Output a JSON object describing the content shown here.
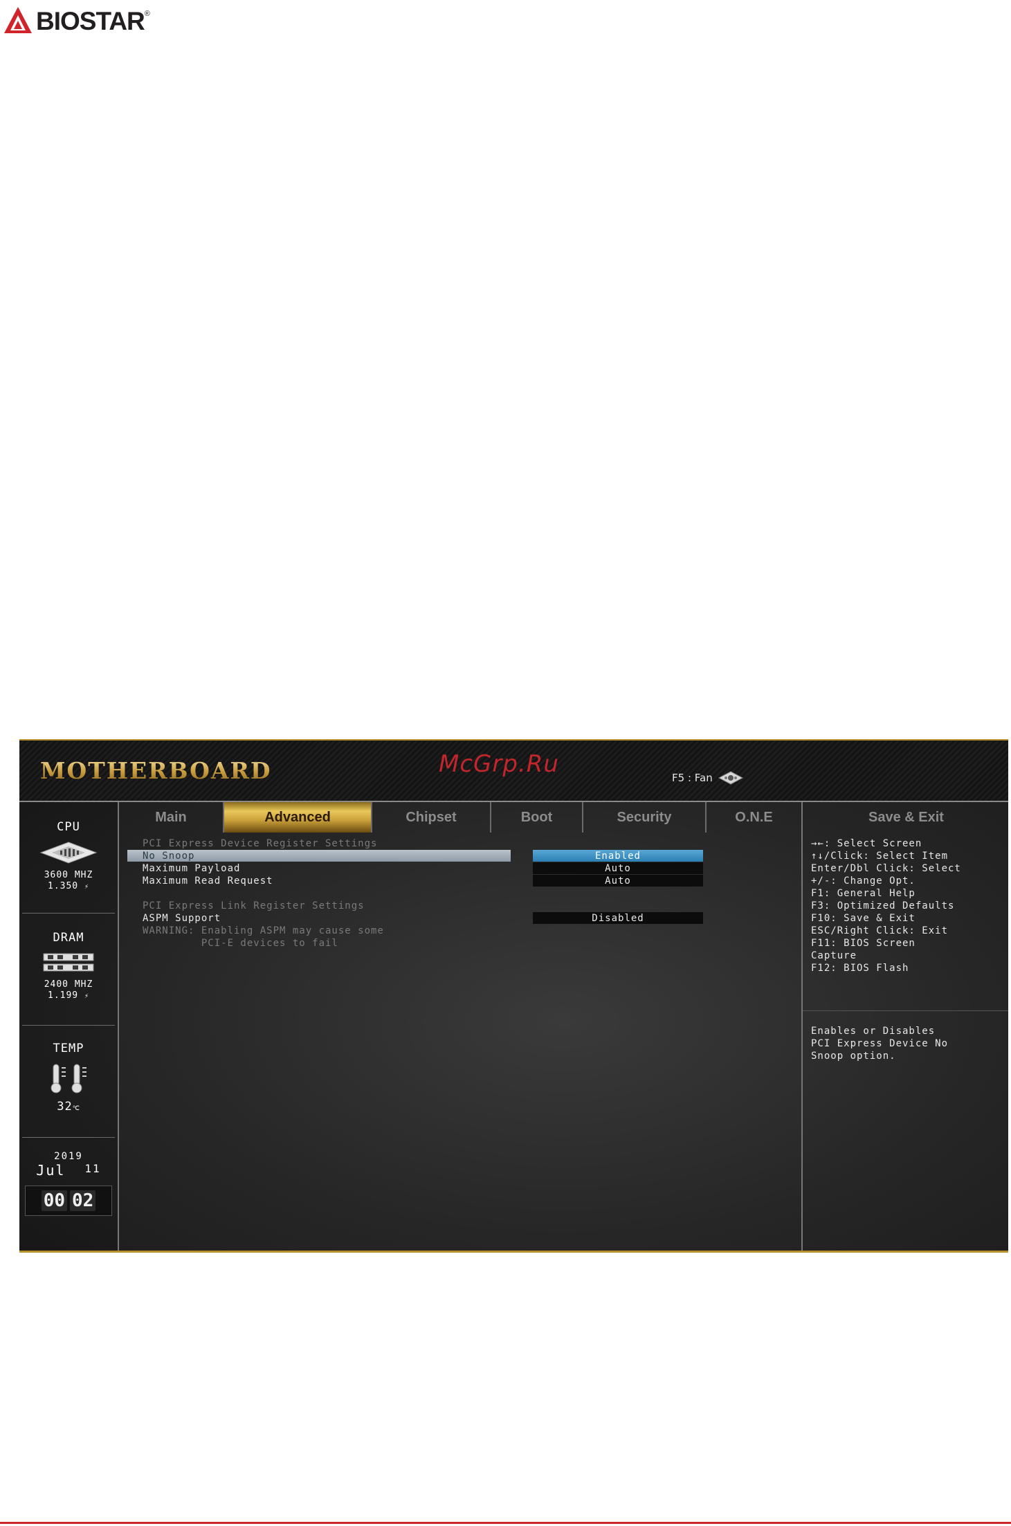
{
  "page": {
    "logo_text": "BIOSTAR",
    "logo_reg": "®"
  },
  "bios": {
    "brand": "MOTHERBOARD",
    "watermark": "McGrp.Ru",
    "f5_label": "F5 : Fan",
    "sidebar": {
      "cpu": {
        "title": "CPU",
        "freq": "3600 MHZ",
        "volt": "1.350",
        "volt_unit": "⚡"
      },
      "dram": {
        "title": "DRAM",
        "freq": "2400 MHZ",
        "volt": "1.199",
        "volt_unit": "⚡"
      },
      "temp": {
        "title": "TEMP",
        "value": "32",
        "unit": "℃"
      },
      "date": {
        "year": "2019",
        "month": "Jul",
        "day": "11"
      },
      "time": {
        "hour": "00",
        "minute": "02"
      }
    },
    "tabs": [
      {
        "label": "Main"
      },
      {
        "label": "Advanced"
      },
      {
        "label": "Chipset"
      },
      {
        "label": "Boot"
      },
      {
        "label": "Security"
      },
      {
        "label": "O.N.E"
      }
    ],
    "save_exit_tab": "Save & Exit",
    "settings": {
      "device_header": "PCI Express Device Register Settings",
      "no_snoop": {
        "label": "No Snoop",
        "value": "Enabled"
      },
      "max_payload": {
        "label": "Maximum Payload",
        "value": "Auto"
      },
      "max_read": {
        "label": "Maximum Read Request",
        "value": "Auto"
      },
      "link_header": "PCI Express Link Register Settings",
      "aspm": {
        "label": "ASPM Support",
        "value": "Disabled"
      },
      "warning_line1": "WARNING: Enabling ASPM may cause some",
      "warning_line2": "         PCI-E devices to fail"
    },
    "help": {
      "keys": [
        "→←: Select Screen",
        "↑↓/Click: Select Item",
        "Enter/Dbl Click: Select",
        "+/-: Change Opt.",
        "F1: General Help",
        "F3: Optimized Defaults",
        "F10: Save & Exit",
        "ESC/Right Click: Exit",
        "F11: BIOS Screen",
        "Capture",
        "F12: BIOS Flash"
      ],
      "description": [
        "Enables or Disables",
        "PCI Express Device No",
        "Snoop option."
      ]
    }
  }
}
